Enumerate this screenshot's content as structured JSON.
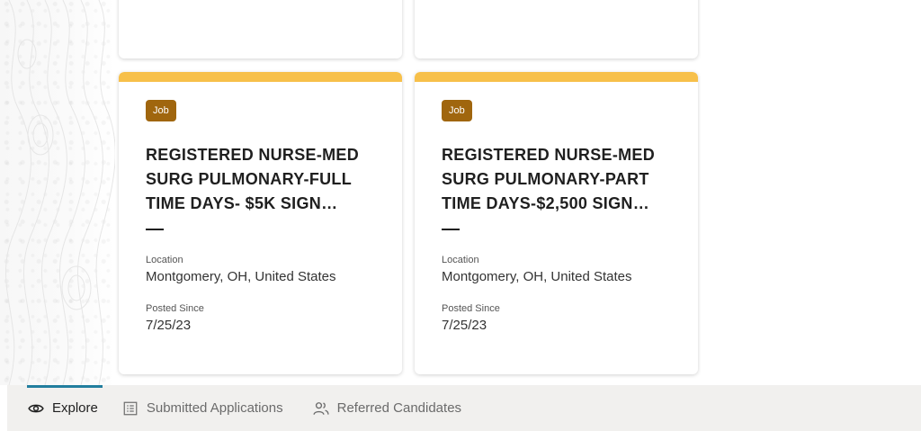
{
  "cards": [
    {
      "badge": "Job",
      "title": "REGISTERED NURSE-MED SURG PULMONARY-FULL TIME DAYS- $5K SIGN…",
      "location_label": "Location",
      "location": "Montgomery, OH, United States",
      "posted_label": "Posted Since",
      "posted": "7/25/23"
    },
    {
      "badge": "Job",
      "title": "REGISTERED NURSE-MED SURG PULMONARY-PART TIME DAYS-$2,500 SIGN…",
      "location_label": "Location",
      "location": "Montgomery, OH, United States",
      "posted_label": "Posted Since",
      "posted": "7/25/23"
    }
  ],
  "nav": {
    "tabs": [
      {
        "label": "Explore",
        "icon": "eye-icon",
        "active": true
      },
      {
        "label": "Submitted Applications",
        "icon": "list-icon",
        "active": false
      },
      {
        "label": "Referred Candidates",
        "icon": "people-icon",
        "active": false
      }
    ]
  },
  "colors": {
    "accent_bar": "#f7c04a",
    "badge_bg": "#a0660e",
    "active_tab_indicator": "#227e9e",
    "nav_bg": "#f1f0ee"
  }
}
